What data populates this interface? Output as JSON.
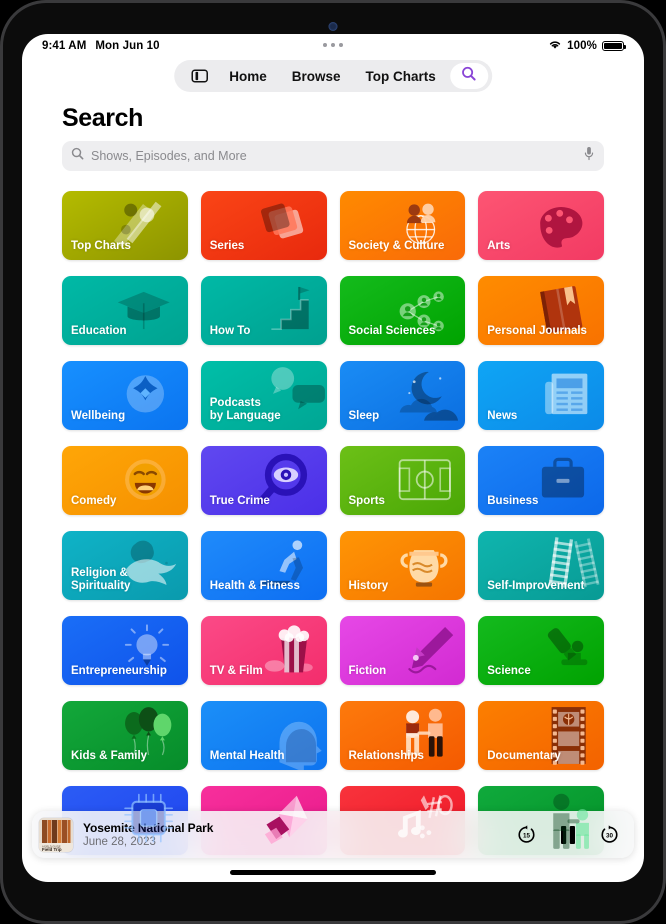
{
  "status_bar": {
    "time": "9:41 AM",
    "date": "Mon Jun 10",
    "battery_percent": "100%",
    "wifi_icon": "wifi-icon",
    "battery_icon": "battery-icon"
  },
  "navbar": {
    "sidebar_icon": "sidebar-icon",
    "items": [
      {
        "label": "Home",
        "active": false
      },
      {
        "label": "Browse",
        "active": false
      },
      {
        "label": "Top Charts",
        "active": false
      }
    ],
    "search_tab": {
      "icon": "search-icon",
      "active": true,
      "accent": "#8944d6"
    }
  },
  "page": {
    "title": "Search"
  },
  "search": {
    "placeholder": "Shows, Episodes, and More",
    "value": "",
    "leading_icon": "search-icon",
    "trailing_icon": "microphone-icon"
  },
  "grid": {
    "tiles": [
      {
        "label": "Top Charts",
        "art": "top-charts-art",
        "c1": "#b4bb00",
        "c2": "#8d9400"
      },
      {
        "label": "Series",
        "art": "series-art",
        "c1": "#fa4516",
        "c2": "#e8290d"
      },
      {
        "label": "Society & Culture",
        "art": "society-culture-art",
        "c1": "#ff8a00",
        "c2": "#f96a08"
      },
      {
        "label": "Arts",
        "art": "arts-art",
        "c1": "#fd5573",
        "c2": "#f23a63"
      },
      {
        "label": "Education",
        "art": "education-art",
        "c1": "#00b9a6",
        "c2": "#00a391"
      },
      {
        "label": "How To",
        "art": "how-to-art",
        "c1": "#00b9a6",
        "c2": "#00a08f"
      },
      {
        "label": "Social Sciences",
        "art": "social-sciences-art",
        "c1": "#14bb1c",
        "c2": "#00a300"
      },
      {
        "label": "Personal Journals",
        "art": "personal-journals-art",
        "c1": "#ff8c00",
        "c2": "#f87200"
      },
      {
        "label": "Wellbeing",
        "art": "wellbeing-art",
        "c1": "#1790ff",
        "c2": "#0b74f0"
      },
      {
        "label": "Podcasts\nby Language",
        "art": "podcasts-language-art",
        "c1": "#00bfa8",
        "c2": "#00a694"
      },
      {
        "label": "Sleep",
        "art": "sleep-art",
        "c1": "#1a8cf5",
        "c2": "#0b6ee0"
      },
      {
        "label": "News",
        "art": "news-art",
        "c1": "#0fa5f5",
        "c2": "#0c8ae8"
      },
      {
        "label": "Comedy",
        "art": "comedy-art",
        "c1": "#ffa607",
        "c2": "#f59000"
      },
      {
        "label": "True Crime",
        "art": "true-crime-art",
        "c1": "#6048f0",
        "c2": "#4b2fe8"
      },
      {
        "label": "Sports",
        "art": "sports-art",
        "c1": "#6cc017",
        "c2": "#4aa706"
      },
      {
        "label": "Business",
        "art": "business-art",
        "c1": "#1b82f7",
        "c2": "#0c68ea"
      },
      {
        "label": "Religion &\nSpirituality",
        "art": "religion-art",
        "c1": "#0fb3c7",
        "c2": "#0a9aad"
      },
      {
        "label": "Health & Fitness",
        "art": "health-fitness-art",
        "c1": "#1f8bfb",
        "c2": "#0d6ef2"
      },
      {
        "label": "History",
        "art": "history-art",
        "c1": "#ff9505",
        "c2": "#f57500"
      },
      {
        "label": "Self-Improvement",
        "art": "self-improvement-art",
        "c1": "#0fb5ae",
        "c2": "#089a94"
      },
      {
        "label": "Entrepreneurship",
        "art": "entrepreneurship-art",
        "c1": "#1a6ef7",
        "c2": "#0f52ea"
      },
      {
        "label": "TV & Film",
        "art": "tv-film-art",
        "c1": "#fb4a87",
        "c2": "#f32d6c"
      },
      {
        "label": "Fiction",
        "art": "fiction-art",
        "c1": "#e648e6",
        "c2": "#d22ad2"
      },
      {
        "label": "Science",
        "art": "science-art",
        "c1": "#14ba1e",
        "c2": "#00a200"
      },
      {
        "label": "Kids & Family",
        "art": "kids-family-art",
        "c1": "#13a83a",
        "c2": "#068c2a"
      },
      {
        "label": "Mental Health",
        "art": "mental-health-art",
        "c1": "#1b8ff8",
        "c2": "#0d73ef"
      },
      {
        "label": "Relationships",
        "art": "relationships-art",
        "c1": "#fd7a0c",
        "c2": "#f45a00"
      },
      {
        "label": "Documentary",
        "art": "documentary-art",
        "c1": "#fc7f00",
        "c2": "#f36200"
      },
      {
        "label": "",
        "art": "technology-art",
        "c1": "#2b5cf5",
        "c2": "#1f43ee"
      },
      {
        "label": "",
        "art": "fashion-beauty-art",
        "c1": "#f72f9c",
        "c2": "#e81a8a"
      },
      {
        "label": "",
        "art": "music-art",
        "c1": "#f8333c",
        "c2": "#ee1726"
      },
      {
        "label": "",
        "art": "parenting-art",
        "c1": "#10aa3c",
        "c2": "#039128"
      }
    ]
  },
  "now_playing": {
    "artwork_caption": "Field Trip",
    "title": "Yosemite National Park",
    "subtitle": "June 28, 2023",
    "skip_back_label": "15",
    "skip_forward_label": "30",
    "play_state_icon": "pause-icon",
    "skip_back_icon": "skip-back-15-icon",
    "skip_forward_icon": "skip-forward-30-icon"
  },
  "home_indicator": "home-indicator"
}
